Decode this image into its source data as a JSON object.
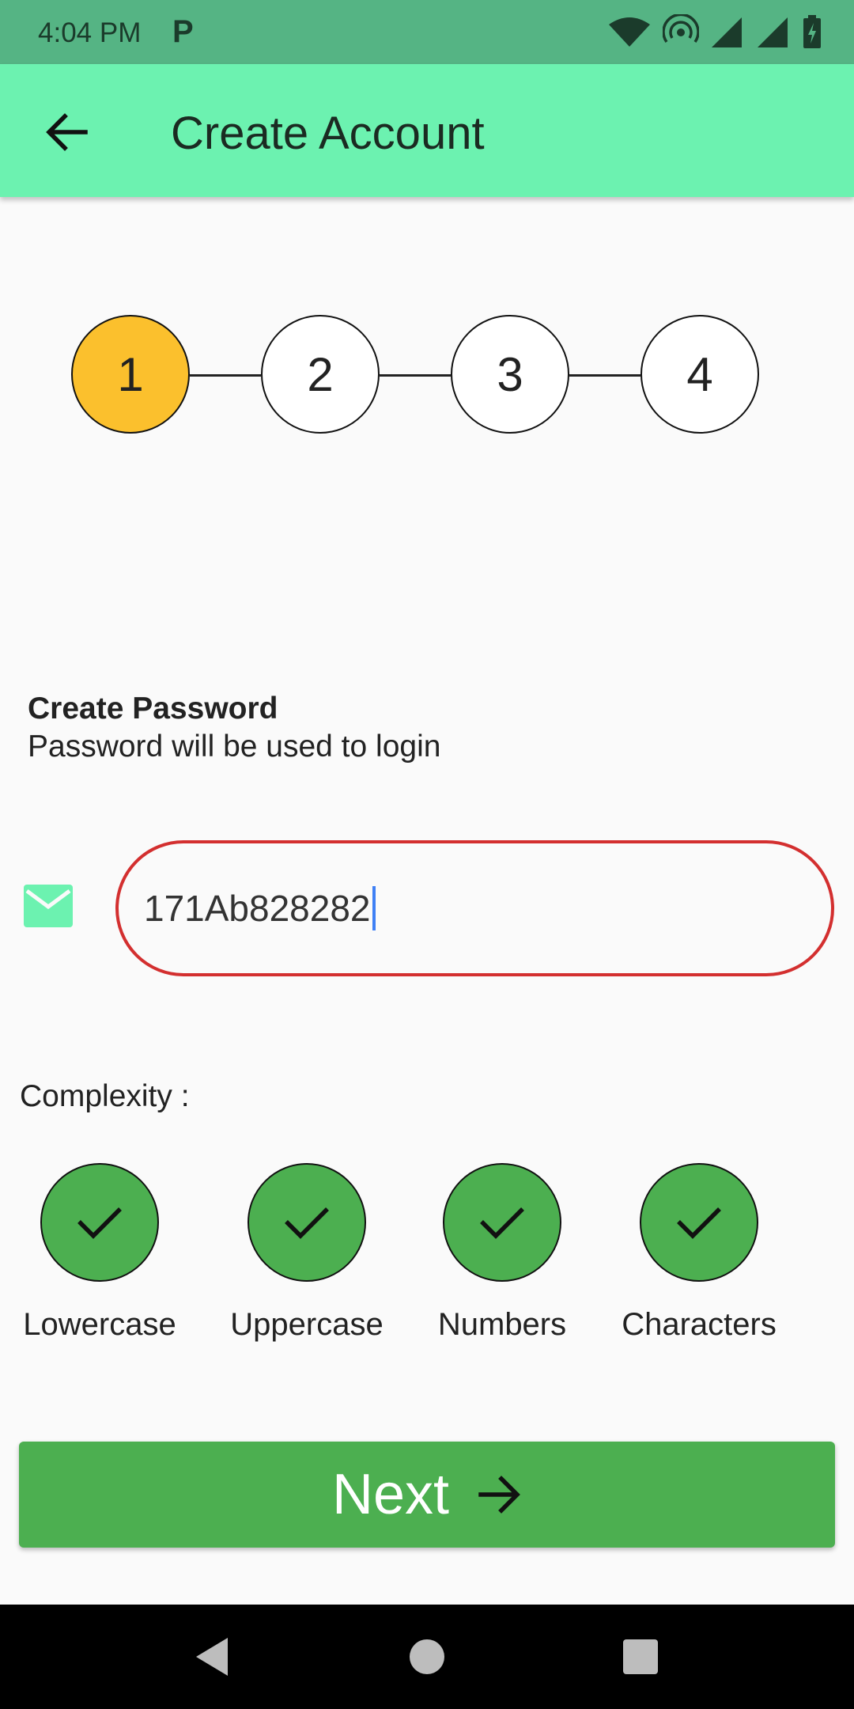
{
  "status_bar": {
    "time": "4:04 PM",
    "app_glyph": "P",
    "icons": [
      "wifi-icon",
      "hotspot-icon",
      "signal-icon",
      "signal-roaming-icon",
      "battery-charging-icon"
    ]
  },
  "app_bar": {
    "title": "Create Account",
    "back_icon": "arrow-left-icon"
  },
  "stepper": {
    "steps": [
      "1",
      "2",
      "3",
      "4"
    ],
    "active_step": 1,
    "active_color": "#FBC02D"
  },
  "form": {
    "title": "Create Password",
    "subtitle": "Password will be used to login",
    "field_icon": "mail-icon",
    "password_value": "171Ab828282",
    "error_border_color": "#D32F2F"
  },
  "complexity": {
    "label": "Complexity :",
    "items": [
      {
        "label": "Lowercase",
        "passed": true
      },
      {
        "label": "Uppercase",
        "passed": true
      },
      {
        "label": "Numbers",
        "passed": true
      },
      {
        "label": "Characters",
        "passed": true
      }
    ],
    "pass_color": "#4CAF50"
  },
  "next_button": {
    "label": "Next",
    "icon": "arrow-right-icon",
    "color": "#4CAF50"
  },
  "nav_bar": {
    "buttons": [
      "back-triangle-icon",
      "home-circle-icon",
      "recents-square-icon"
    ]
  },
  "colors": {
    "status_bar": "#55B484",
    "app_bar": "#6CF2B0",
    "background": "#FAFAFA"
  }
}
